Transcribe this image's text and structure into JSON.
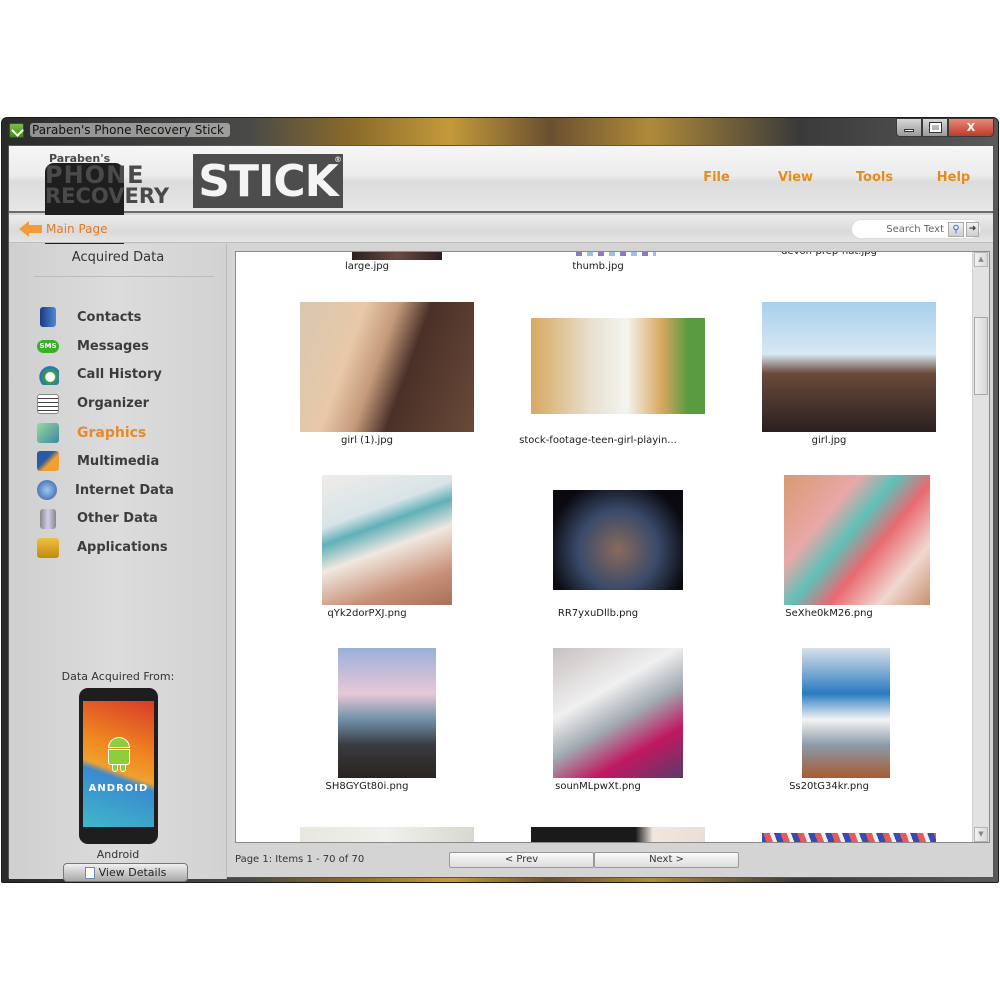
{
  "window": {
    "title": "Paraben's Phone Recovery Stick",
    "controls": {
      "minimize": "minimize",
      "maximize": "maximize",
      "close": "X"
    }
  },
  "logo": {
    "small": "Paraben's",
    "line1": "PHONE",
    "line2": "RECOVERY",
    "badge": "STICK",
    "reg": "®"
  },
  "menu": [
    {
      "label": "File"
    },
    {
      "label": "View"
    },
    {
      "label": "Tools"
    },
    {
      "label": "Help"
    }
  ],
  "navbar": {
    "back_label": "Main Page",
    "search_placeholder": "Search Text",
    "search_icon": "magnifier-icon",
    "go_icon": "arrow-right-icon"
  },
  "sidebar": {
    "title": "Acquired Data",
    "items": [
      {
        "label": "Contacts",
        "icon": "contacts-icon",
        "active": false
      },
      {
        "label": "Messages",
        "icon": "sms-icon",
        "active": false
      },
      {
        "label": "Call History",
        "icon": "call-history-icon",
        "active": false
      },
      {
        "label": "Organizer",
        "icon": "organizer-icon",
        "active": false
      },
      {
        "label": "Graphics",
        "icon": "graphics-icon",
        "active": true
      },
      {
        "label": "Multimedia",
        "icon": "multimedia-icon",
        "active": false
      },
      {
        "label": "Internet Data",
        "icon": "globe-icon",
        "active": false
      },
      {
        "label": "Other Data",
        "icon": "database-icon",
        "active": false
      },
      {
        "label": "Applications",
        "icon": "applications-icon",
        "active": false
      }
    ],
    "sms_badge": "SMS",
    "acquired_from_label": "Data Acquired From:",
    "device_screen_text": "ANDROID",
    "device_name": "Android",
    "view_details_label": "View Details"
  },
  "gallery": {
    "rows": [
      [
        "large.jpg",
        "thumb.jpg",
        "devon-prep-hat.jpg"
      ],
      [
        "girl (1).jpg",
        "stock-footage-teen-girl-playin...",
        "girl.jpg"
      ],
      [
        "qYk2dorPXJ.png",
        "RR7yxuDllb.png",
        "SeXhe0kM26.png"
      ],
      [
        "SH8GYGt80i.png",
        "sounMLpwXt.png",
        "Ss20tG34kr.png"
      ]
    ]
  },
  "status": {
    "page_info": "Page 1: Items 1 - 70 of 70",
    "prev_label": "< Prev",
    "next_label": "Next >"
  },
  "colors": {
    "accent_orange": "#e8892a",
    "menu_orange": "#e48c1c",
    "logo_gray": "#4d4d4d"
  }
}
